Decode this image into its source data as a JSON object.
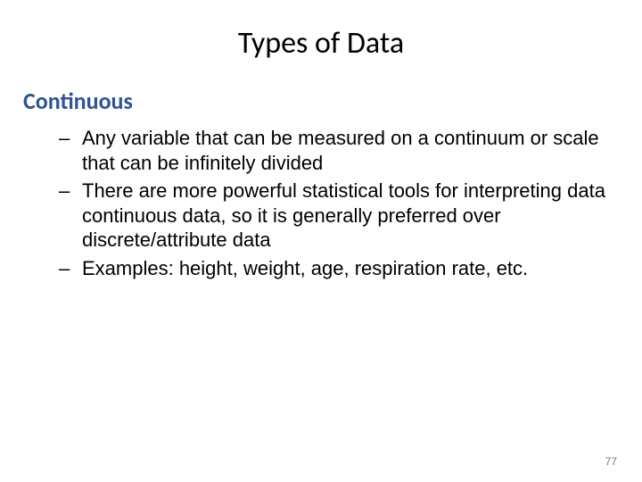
{
  "title": "Types of Data",
  "subhead": "Continuous",
  "bullets": [
    "Any variable that can be measured on a continuum or scale that can be infinitely divided",
    "There are more powerful statistical tools for interpreting data continuous data, so it is generally preferred over discrete/attribute data",
    "Examples: height, weight, age, respiration rate, etc."
  ],
  "page_number": "77"
}
